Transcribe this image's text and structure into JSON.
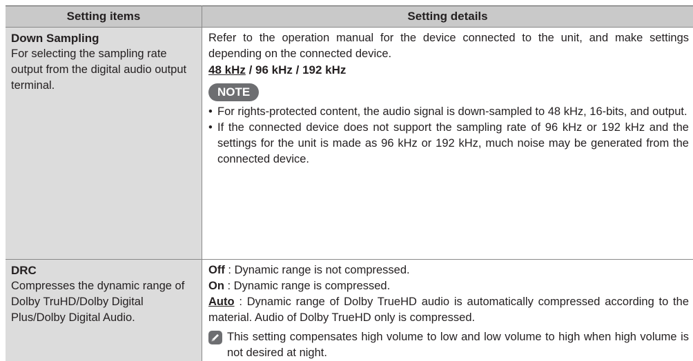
{
  "header": {
    "col1": "Setting items",
    "col2": "Setting details"
  },
  "down_sampling": {
    "title": "Down Sampling",
    "description": "For selecting the sampling rate output from the digital audio output terminal.",
    "detail": "Refer to the operation manual for the device connected to the unit, and make settings depending on the connected device.",
    "option_default": "48 kHz",
    "option_rest": " / 96 kHz / 192 kHz",
    "note_label": "NOTE",
    "notes": [
      "For rights-protected content, the audio signal is down-sampled to 48 kHz, 16-bits, and output.",
      "If the connected device does not support the sampling rate of 96 kHz or 192 kHz and the settings for the unit is made as 96 kHz or 192 kHz, much noise may be generated from the connected device."
    ]
  },
  "drc": {
    "title": "DRC",
    "description": "Compresses the dynamic range of Dolby TruHD/Dolby Digital Plus/Dolby Digital Audio.",
    "options": [
      {
        "name": "Off",
        "text": " : Dynamic range is not compressed."
      },
      {
        "name": "On",
        "text": " : Dynamic range is compressed."
      },
      {
        "name": "Auto",
        "text": " : Dynamic range of Dolby TrueHD audio is automatically compressed according to the material. Audio of Dolby TrueHD only is compressed."
      }
    ],
    "tip_icon": "pencil-icon",
    "tip": "This setting compensates high volume to low and low volume to high when high volume is not desired at night."
  }
}
